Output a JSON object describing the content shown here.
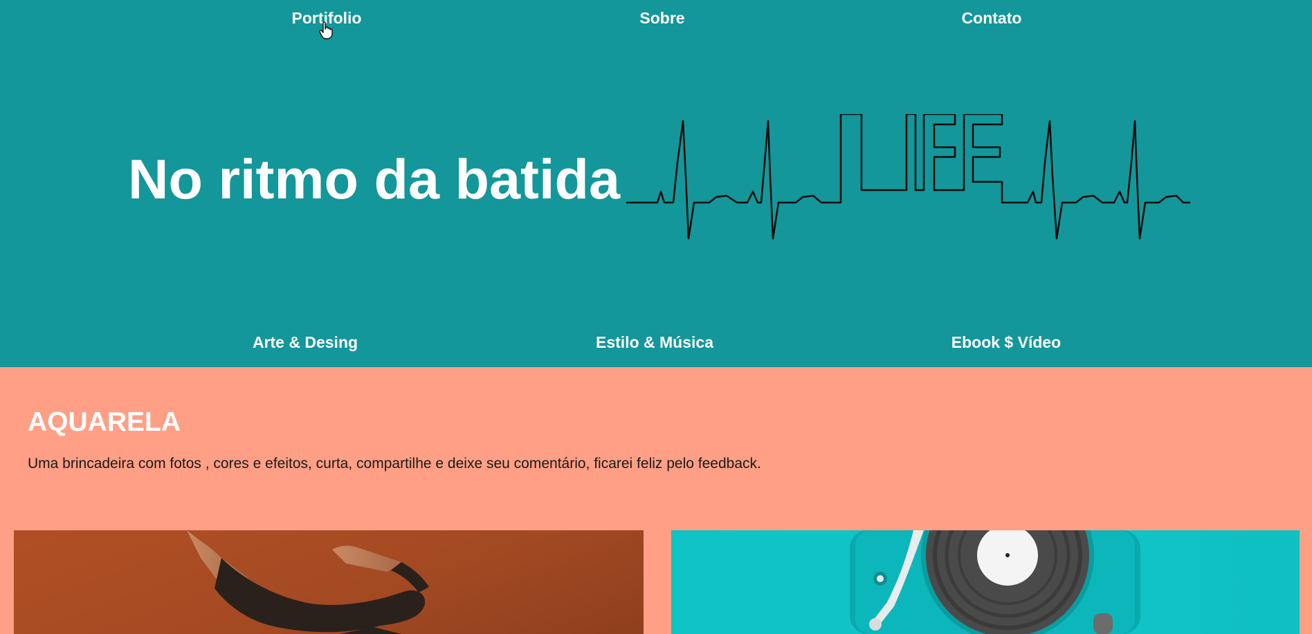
{
  "topnav": {
    "items": [
      {
        "label": "Portifolio"
      },
      {
        "label": "Sobre"
      },
      {
        "label": "Contato"
      }
    ]
  },
  "hero": {
    "headline": "No ritmo da batida",
    "graphic_text": "LIFE",
    "background": "#13979a"
  },
  "subnav": {
    "items": [
      {
        "label": "Arte & Desing"
      },
      {
        "label": "Estilo & Música"
      },
      {
        "label": "Ebook $ Vídeo"
      }
    ]
  },
  "section": {
    "title": "AQUARELA",
    "description": "Uma brincadeira com fotos , cores e efeitos, curta, compartilhe e deixe seu comentário, ficarei feliz pelo feedback.",
    "background": "#ff9f85"
  },
  "gallery": {
    "items": [
      {
        "subject": "dancer"
      },
      {
        "subject": "turntable"
      }
    ]
  },
  "cursor": {
    "type": "hand-pointer-icon"
  }
}
